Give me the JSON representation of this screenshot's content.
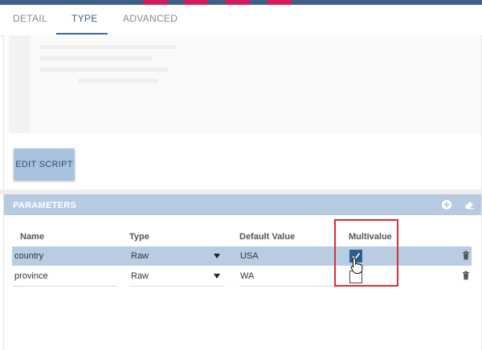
{
  "tabs": [
    {
      "label": "DETAIL",
      "active": false
    },
    {
      "label": "TYPE",
      "active": true
    },
    {
      "label": "ADVANCED",
      "active": false
    }
  ],
  "editor": {
    "edit_button_label": "EDIT SCRIPT"
  },
  "parameters": {
    "title": "PARAMETERS",
    "header_icons": [
      "plus-circle-icon",
      "eraser-icon"
    ],
    "columns": [
      "Name",
      "Type",
      "Default Value",
      "Multivalue"
    ],
    "rows": [
      {
        "name": "country",
        "type": "Raw",
        "default_value": "USA",
        "multivalue": true,
        "selected": true
      },
      {
        "name": "province",
        "type": "Raw",
        "default_value": "WA",
        "multivalue": false,
        "selected": false
      }
    ]
  },
  "colors": {
    "accent": "#3a6a96",
    "header_bar": "#3c5f85",
    "magenta_dot": "#d11c5e",
    "params_header": "#b6cbe0",
    "selected_row": "#b8cde2",
    "checkbox_checked": "#2f5c8c",
    "highlight_red": "#d93030"
  }
}
